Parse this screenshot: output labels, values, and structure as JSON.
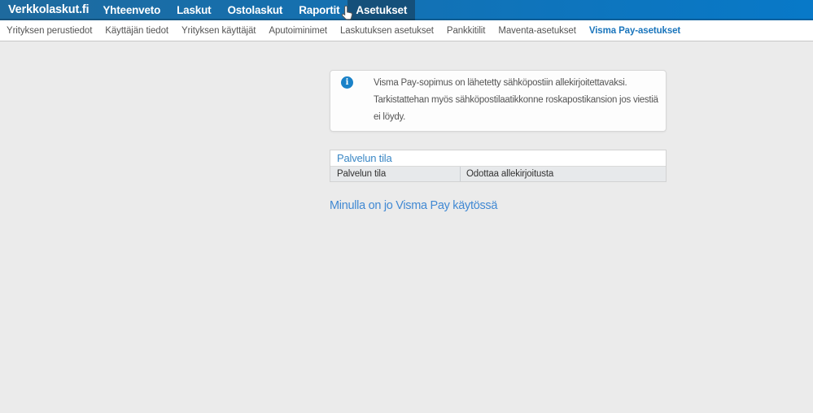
{
  "topnav": {
    "brand": "Verkkolaskut.fi",
    "items": [
      {
        "label": "Yhteenveto"
      },
      {
        "label": "Laskut"
      },
      {
        "label": "Ostolaskut"
      },
      {
        "label": "Raportit"
      },
      {
        "label": "Asetukset"
      }
    ]
  },
  "subnav": {
    "items": [
      {
        "label": "Yrityksen perustiedot"
      },
      {
        "label": "Käyttäjän tiedot"
      },
      {
        "label": "Yrityksen käyttäjät"
      },
      {
        "label": "Aputoiminimet"
      },
      {
        "label": "Laskutuksen asetukset"
      },
      {
        "label": "Pankkitilit"
      },
      {
        "label": "Maventa-asetukset"
      },
      {
        "label": "Visma Pay-asetukset"
      }
    ]
  },
  "content": {
    "info_alert": {
      "icon_glyph": "i",
      "text": "Visma Pay-sopimus on lähetetty sähköpostiin allekirjoitettavaksi. Tarkistattehan myös sähköpostilaatikkonne roskapostikansion jos viestiä ei löydy."
    },
    "service_panel": {
      "title": "Palvelun tila",
      "rows": [
        {
          "label": "Palvelun tila",
          "value": "Odottaa allekirjoitusta"
        }
      ]
    },
    "existing_pay_link": "Minulla on jo Visma Pay käytössä"
  },
  "colors": {
    "topnav_gradient_start": "#1e6a9e",
    "topnav_gradient_end": "#0879c8",
    "topnav_active_bg": "#15507a",
    "subnav_active_blue": "#1a75bc",
    "info_icon_blue": "#1a82c8",
    "panel_title_blue": "#3a87c5",
    "link_blue": "#4189d3",
    "page_bg": "#ebebeb",
    "row_bg": "#e7e9eb"
  }
}
